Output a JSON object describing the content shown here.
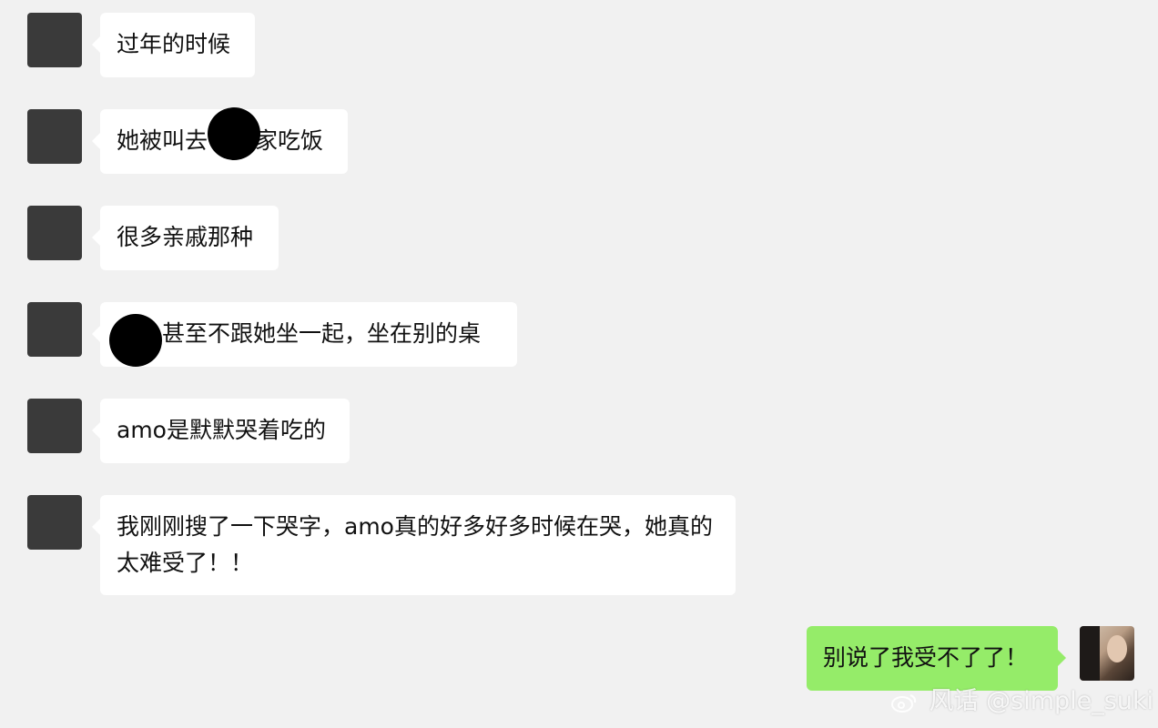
{
  "messages": [
    {
      "sender": "other",
      "text": "过年的时候"
    },
    {
      "sender": "other",
      "text": "她被叫去"
    },
    {
      "sender": "other",
      "text": "家吃饭"
    },
    {
      "sender": "other",
      "text": "很多亲戚那种"
    },
    {
      "sender": "other",
      "text": "甚至不跟她坐一起，坐在别的桌"
    },
    {
      "sender": "other",
      "text": "amo是默默哭着吃的"
    },
    {
      "sender": "other",
      "text": "我刚刚搜了一下哭字，amo真的好多好多时候在哭，她真的太难受了！！"
    },
    {
      "sender": "me",
      "text": "别说了我受不了了！"
    }
  ],
  "watermark": {
    "text": "风话 @simple_suki"
  },
  "colors": {
    "background": "#f1f1f1",
    "bubble_other": "#ffffff",
    "bubble_me": "#95ec69",
    "avatar_placeholder": "#3a3a3a",
    "redaction": "#000000"
  }
}
